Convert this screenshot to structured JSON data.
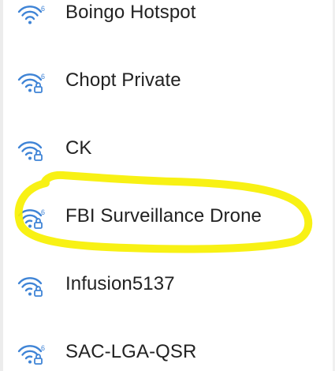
{
  "wifi_list": {
    "networks": [
      {
        "name": "Boingo Hotspot",
        "icon": "wifi-6-icon",
        "secured": false
      },
      {
        "name": "Chopt Private",
        "icon": "wifi-6-lock-icon",
        "secured": true
      },
      {
        "name": "CK",
        "icon": "wifi-lock-icon",
        "secured": true
      },
      {
        "name": "FBI Surveillance Drone",
        "icon": "wifi-6-lock-icon",
        "secured": true
      },
      {
        "name": "Infusion5137",
        "icon": "wifi-lock-icon",
        "secured": true
      },
      {
        "name": "SAC-LGA-QSR",
        "icon": "wifi-6-lock-icon",
        "secured": true
      }
    ]
  },
  "colors": {
    "wifi_icon": "#3f84d6",
    "text": "#222222",
    "highlight": "#f7f000"
  }
}
